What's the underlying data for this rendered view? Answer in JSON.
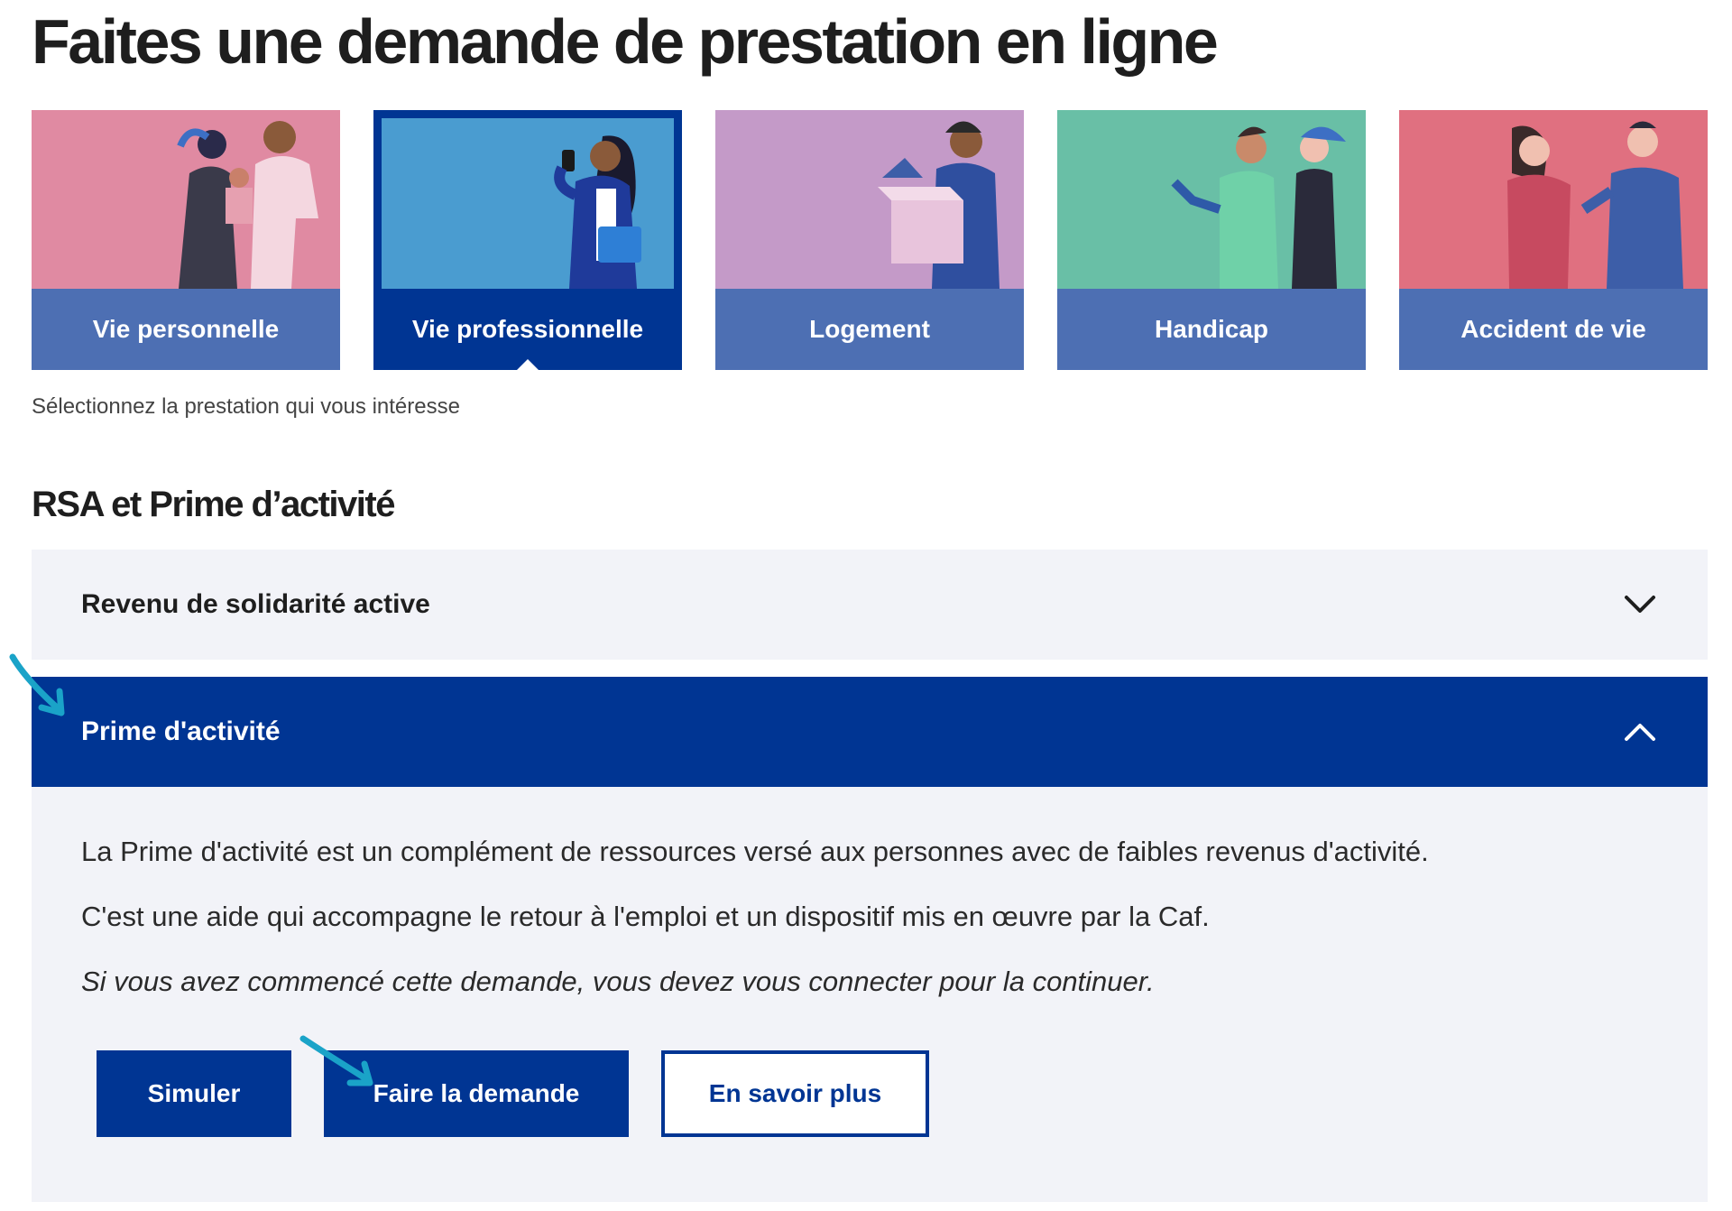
{
  "page": {
    "title": "Faites une demande de prestation en ligne"
  },
  "categories": [
    {
      "label": "Vie personnelle",
      "active": false,
      "bg": "#e08aa2",
      "icon": "family-illustration"
    },
    {
      "label": "Vie professionnelle",
      "active": true,
      "bg": "#4a9cd0",
      "icon": "worker-phone-illustration"
    },
    {
      "label": "Logement",
      "active": false,
      "bg": "#c49ac8",
      "icon": "moving-box-illustration"
    },
    {
      "label": "Handicap",
      "active": false,
      "bg": "#69bfa6",
      "icon": "prosthetic-arm-illustration"
    },
    {
      "label": "Accident de vie",
      "active": false,
      "bg": "#e07080",
      "icon": "comforting-illustration"
    }
  ],
  "hint": "Sélectionnez la prestation qui vous intéresse",
  "section": {
    "title": "RSA et Prime d’activité",
    "accordion": [
      {
        "label": "Revenu de solidarité active",
        "expanded": false,
        "icon": "chevron-down-icon"
      },
      {
        "label": "Prime d'activité",
        "expanded": true,
        "icon": "chevron-up-icon",
        "paragraphs": [
          "La Prime d'activité est un complément de ressources versé aux personnes avec de faibles revenus d'activité.",
          "C'est une aide qui accompagne le retour à l'emploi et un dispositif mis en œuvre par la Caf.",
          "Si vous avez commencé cette demande, vous devez vous connecter pour la continuer."
        ],
        "buttons": {
          "simulate": "Simuler",
          "apply": "Faire la demande",
          "learn_more": "En savoir plus"
        }
      }
    ]
  },
  "colors": {
    "primary": "#003593",
    "card_label": "#4d6fb3",
    "panel_bg": "#f2f3f8",
    "annotation_arrow": "#1aa3c8"
  }
}
